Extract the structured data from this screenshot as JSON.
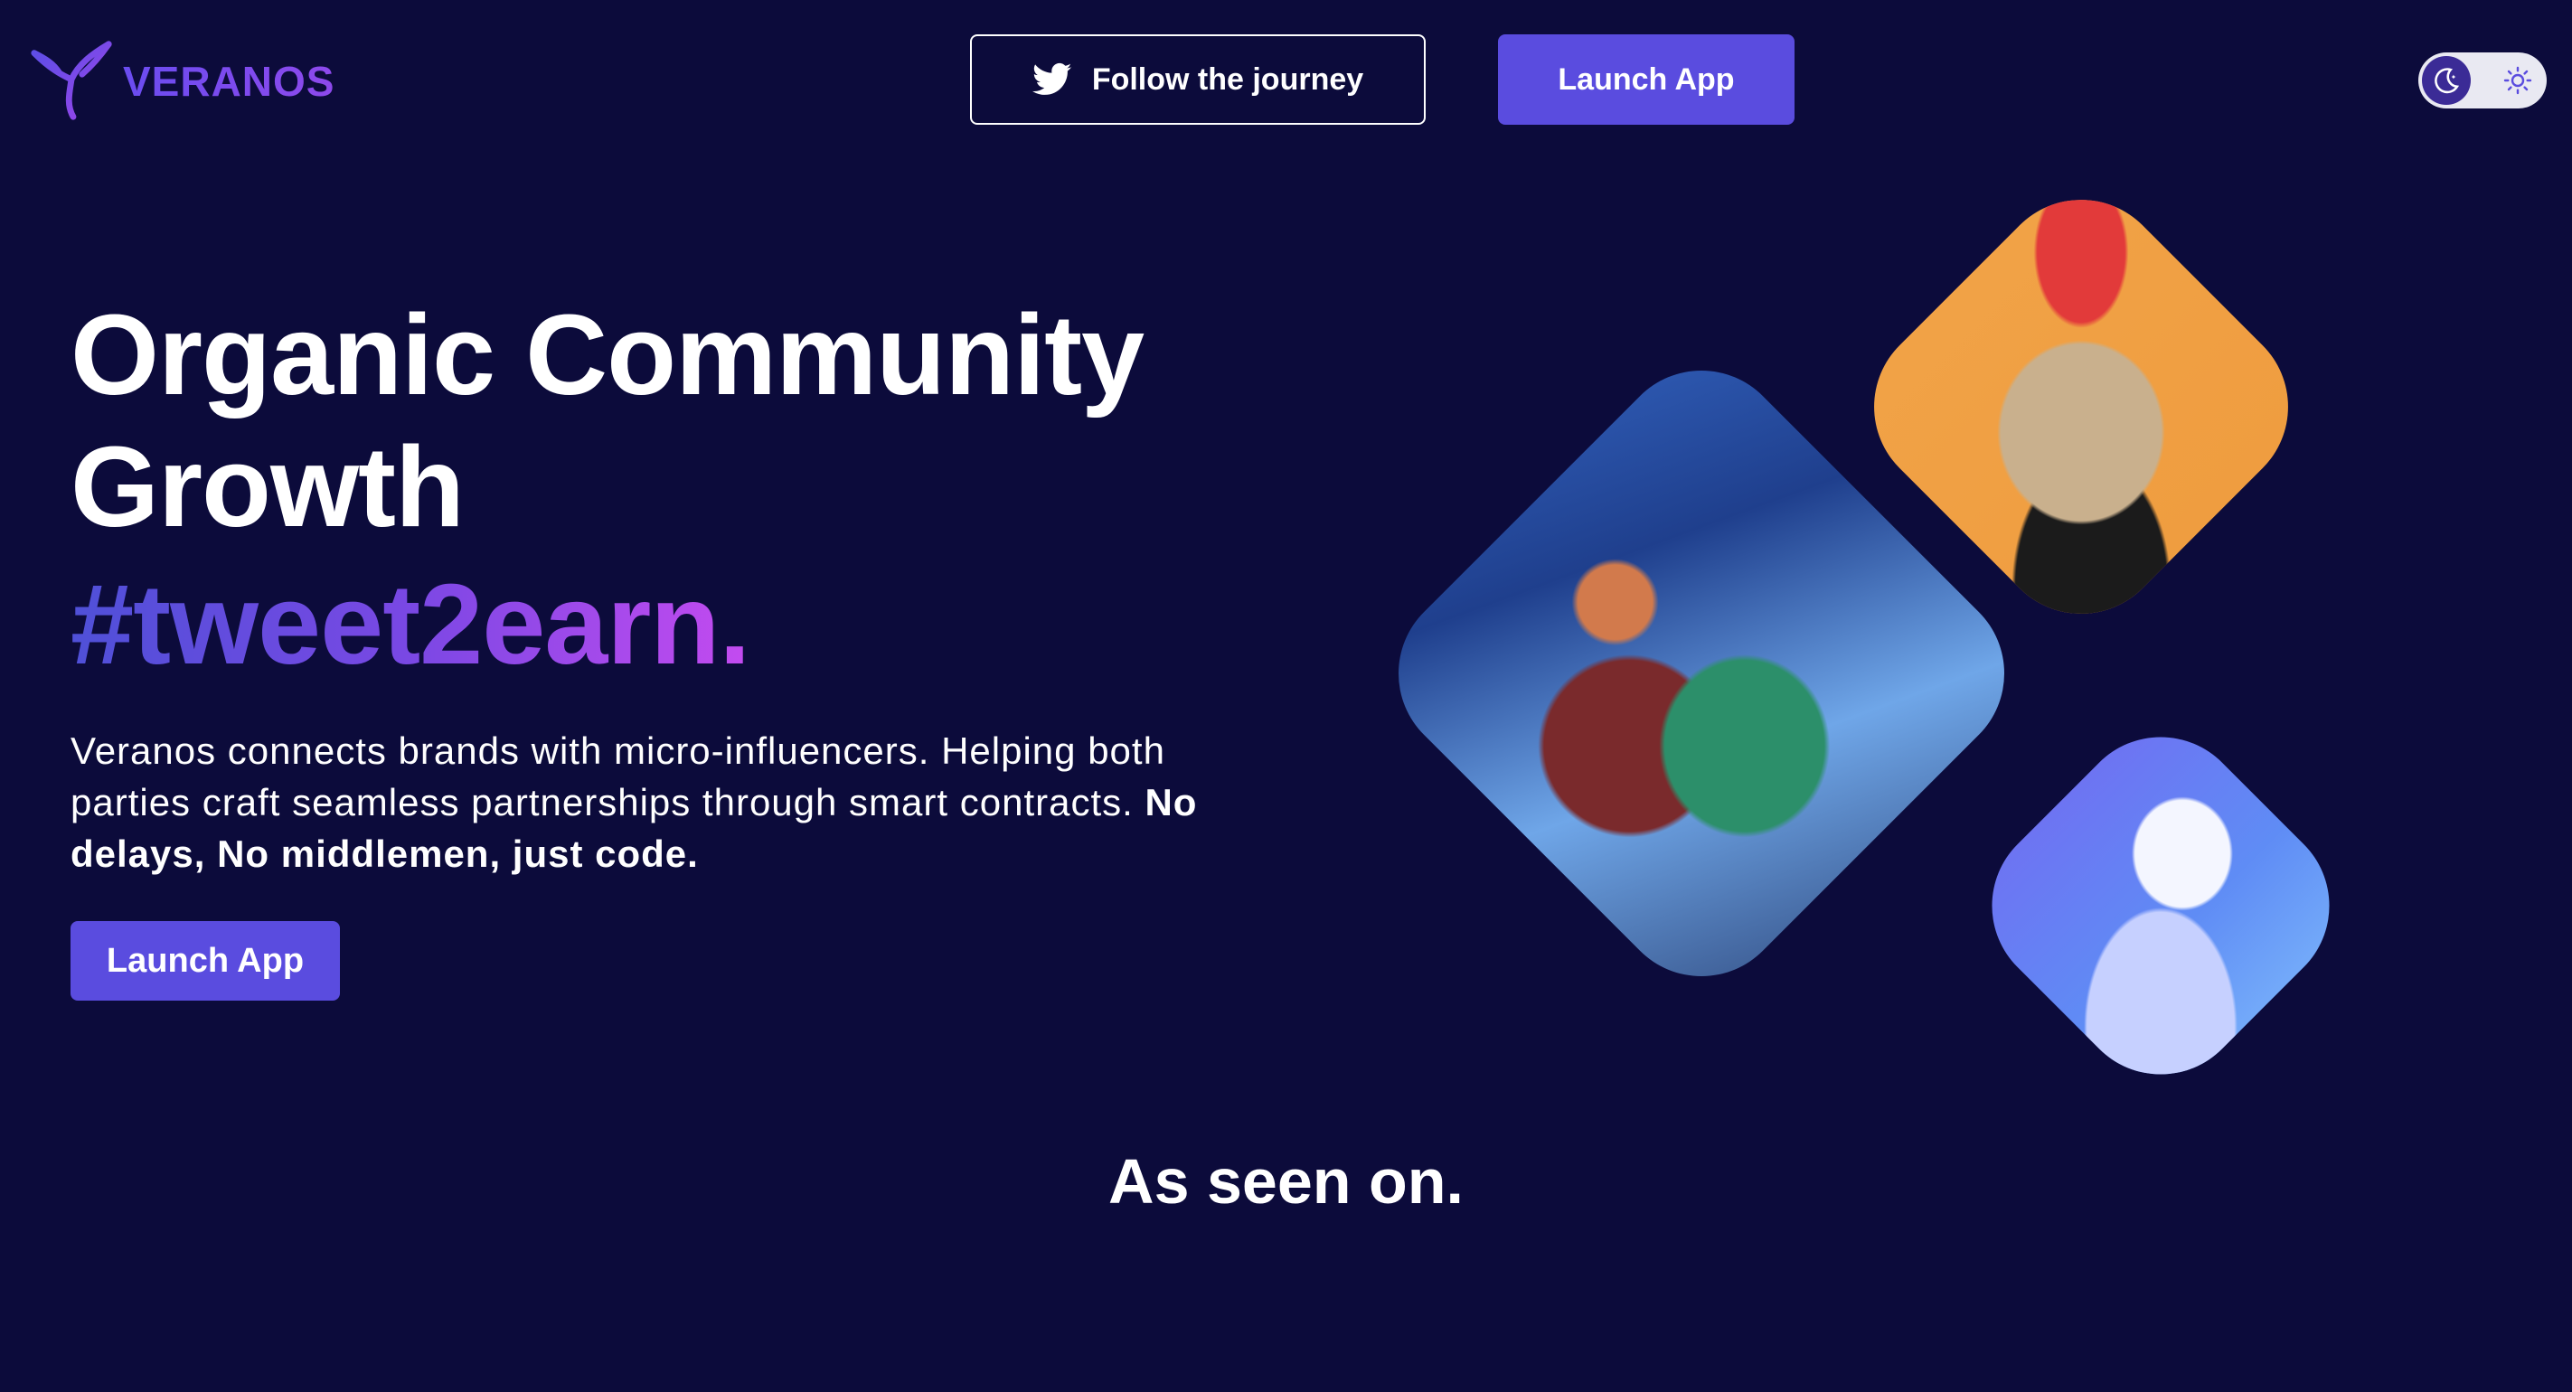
{
  "header": {
    "logo_text": "VERANOS",
    "follow_label": "Follow the journey",
    "launch_label": "Launch App"
  },
  "theme_toggle": {
    "mode_icon": "moon-icon",
    "alt_icon": "sun-icon"
  },
  "hero": {
    "title_line1": "Organic Community",
    "title_line2": "Growth",
    "hashtag": "#tweet2earn.",
    "description": "Veranos connects brands with micro-influencers. Helping both parties craft seamless partnerships through smart contracts.",
    "description_bold": "No delays, No middlemen, just code.",
    "launch_label": "Launch App"
  },
  "images": [
    {
      "name": "game-characters-image"
    },
    {
      "name": "bored-ape-image"
    },
    {
      "name": "vr-headset-image"
    }
  ],
  "as_seen_on": "As seen on.",
  "colors": {
    "background": "#0c0b3b",
    "accent": "#5a4cdf",
    "gradient_start": "#4f50d8",
    "gradient_end": "#c44bf0"
  }
}
